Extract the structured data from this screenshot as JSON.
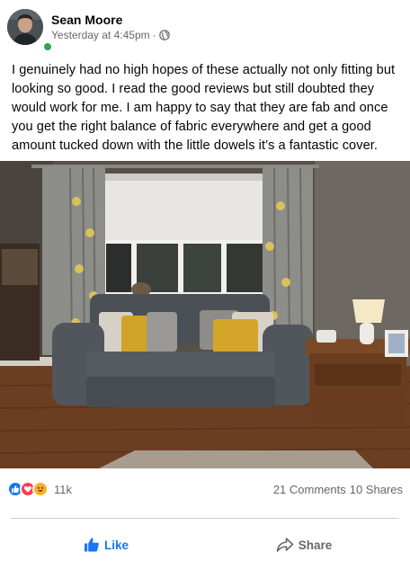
{
  "post": {
    "author": "Sean Moore",
    "timestamp": "Yesterday at 4:45pm",
    "separator": "·",
    "privacy_icon": "globe-icon",
    "text": "I genuinely had no high hopes of these actually not only fitting but looking so good. I read the good reviews but still doubted they would work for me. I am happy to say that they are fab and once you get the right balance of fabric everywhere and get a good amount tucked down with the little dowels it’s a fantastic cover.",
    "online": true
  },
  "reactions": {
    "icons": [
      "like-icon",
      "love-icon",
      "haha-icon"
    ],
    "count": "11k",
    "comments": "21 Comments",
    "shares": "10 Shares"
  },
  "actions": {
    "like_label": "Like",
    "share_label": "Share"
  },
  "colors": {
    "like_blue": "#1877f2",
    "love_red": "#f33e58",
    "haha_yellow": "#f7b125",
    "meta_gray": "#65676b",
    "online_green": "#31a24c"
  }
}
